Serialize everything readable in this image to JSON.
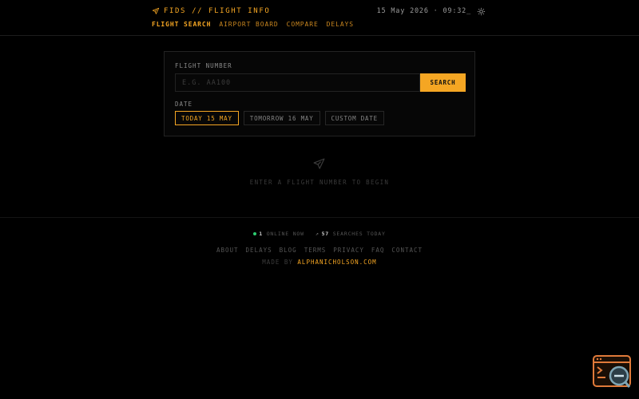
{
  "header": {
    "brand": "FIDS // FLIGHT INFO",
    "clock": "15 May 2026 · 09:32_",
    "nav": [
      {
        "label": "FLIGHT SEARCH",
        "active": true
      },
      {
        "label": "AIRPORT BOARD",
        "active": false
      },
      {
        "label": "COMPARE",
        "active": false
      },
      {
        "label": "DELAYS",
        "active": false
      }
    ]
  },
  "search": {
    "flight_label": "FLIGHT NUMBER",
    "flight_placeholder": "E.G. AA100",
    "flight_value": "",
    "search_label": "SEARCH",
    "date_label": "DATE",
    "date_options": [
      {
        "label": "TODAY 15 MAY",
        "selected": true
      },
      {
        "label": "TOMORROW 16 MAY",
        "selected": false
      },
      {
        "label": "CUSTOM DATE",
        "selected": false
      }
    ]
  },
  "empty_state": {
    "icon": "plane-icon",
    "text": "ENTER A FLIGHT NUMBER TO BEGIN"
  },
  "footer": {
    "online_count": "1",
    "online_label": "ONLINE NOW",
    "searches_count": "57",
    "searches_label": "SEARCHES TODAY",
    "links": [
      "ABOUT",
      "DELAYS",
      "BLOG",
      "TERMS",
      "PRIVACY",
      "FAQ",
      "CONTACT"
    ],
    "made_by_prefix": "MADE BY",
    "made_by_link": "ALPHANICHOLSON.COM"
  },
  "colors": {
    "accent": "#f5a623",
    "background": "#000000",
    "online_dot": "#2ecc71"
  }
}
